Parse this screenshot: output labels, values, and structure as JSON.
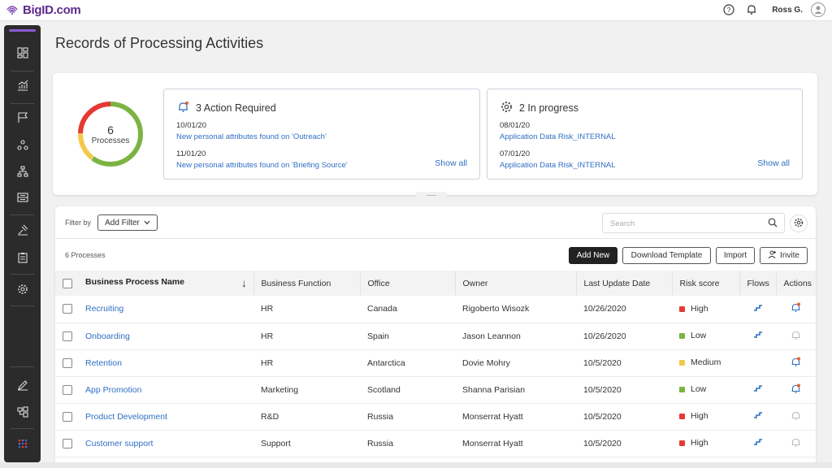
{
  "header": {
    "brand": "BigID.com",
    "user_name": "Ross G.",
    "icons": [
      "fingerprint-logo-icon",
      "help-icon",
      "bell-icon",
      "user-avatar-icon"
    ]
  },
  "sidebar": {
    "items": [
      "dashboard-icon",
      "analytics-icon",
      "flag-icon",
      "data-catalog-icon",
      "hierarchy-icon",
      "inbox-icon",
      "remediation-icon",
      "clipboard-icon",
      "settings-icon",
      "pen-icon",
      "data-flow-icon",
      "apps-grid-icon"
    ]
  },
  "page": {
    "title": "Records of Processing Activities"
  },
  "summary": {
    "donut": {
      "value": "6",
      "label": "Processes",
      "colors": [
        "#7cb342",
        "#e53935",
        "#f2c94c"
      ]
    },
    "action_card": {
      "title": "3 Action Required",
      "entries": [
        {
          "date": "10/01/20",
          "text": "New personal attributes found on 'Outreach'"
        },
        {
          "date": "11/01/20",
          "text": "New personal attributes found on 'Briefing Source'"
        }
      ],
      "show_all": "Show all"
    },
    "progress_card": {
      "title": "2 In progress",
      "entries": [
        {
          "date": "08/01/20",
          "text": "Application Data Risk_INTERNAL"
        },
        {
          "date": "07/01/20",
          "text": "Application Data Risk_INTERNAL"
        }
      ],
      "show_all": "Show all"
    }
  },
  "toolbar": {
    "filter_label": "Filter by",
    "add_filter": "Add Filter",
    "search_placeholder": "Search",
    "count_label": "6 Processes",
    "add_new": "Add New",
    "download_template": "Download Template",
    "import": "Import",
    "invite": "Invite"
  },
  "table": {
    "columns": [
      "Business Process Name",
      "Business Function",
      "Office",
      "Owner",
      "Last Update Date",
      "Risk score",
      "Flows",
      "Actions"
    ],
    "rows": [
      {
        "name": "Recruiting",
        "function": "HR",
        "office": "Canada",
        "owner": "Rigoberto Wisozk",
        "date": "10/26/2020",
        "risk": "High",
        "risk_color": "#e53935",
        "flow": true,
        "action_alert": true
      },
      {
        "name": "Onboarding",
        "function": "HR",
        "office": "Spain",
        "owner": "Jason Leannon",
        "date": "10/26/2020",
        "risk": "Low",
        "risk_color": "#7cb342",
        "flow": true,
        "action_alert": false
      },
      {
        "name": "Retention",
        "function": "HR",
        "office": "Antarctica",
        "owner": "Dovie Mohry",
        "date": "10/5/2020",
        "risk": "Medium",
        "risk_color": "#f2c94c",
        "flow": false,
        "action_alert": true
      },
      {
        "name": "App Promotion",
        "function": "Marketing",
        "office": "Scotland",
        "owner": "Shanna Parisian",
        "date": "10/5/2020",
        "risk": "Low",
        "risk_color": "#7cb342",
        "flow": true,
        "action_alert": true
      },
      {
        "name": "Product Development",
        "function": "R&D",
        "office": "Russia",
        "owner": "Monserrat Hyatt",
        "date": "10/5/2020",
        "risk": "High",
        "risk_color": "#e53935",
        "flow": true,
        "action_alert": false
      },
      {
        "name": "Customer support",
        "function": "Support",
        "office": "Russia",
        "owner": "Monserrat Hyatt",
        "date": "10/5/2020",
        "risk": "High",
        "risk_color": "#e53935",
        "flow": true,
        "action_alert": false
      }
    ]
  }
}
